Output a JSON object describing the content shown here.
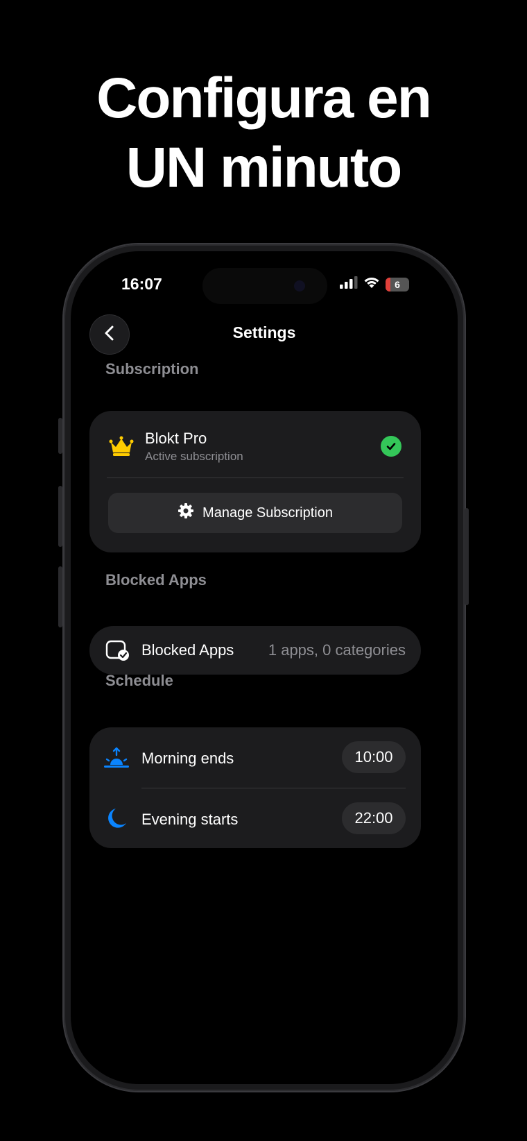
{
  "headline": {
    "line1": "Configura en",
    "line2": "UN minuto"
  },
  "status_bar": {
    "time": "16:07",
    "battery": "6"
  },
  "nav": {
    "title": "Settings"
  },
  "subscription": {
    "section_label": "Subscription",
    "plan_name": "Blokt Pro",
    "plan_status": "Active subscription",
    "manage_label": "Manage Subscription"
  },
  "blocked_apps": {
    "section_label": "Blocked Apps",
    "row_label": "Blocked Apps",
    "row_value": "1 apps, 0 categories"
  },
  "schedule": {
    "section_label": "Schedule",
    "rows": [
      {
        "label": "Morning ends",
        "time": "10:00",
        "icon": "sunrise-icon"
      },
      {
        "label": "Evening starts",
        "time": "22:00",
        "icon": "moon-icon"
      }
    ]
  },
  "colors": {
    "accent_blue": "#0a84ff",
    "success_green": "#34c759",
    "crown_gold": "#ffcc00"
  }
}
